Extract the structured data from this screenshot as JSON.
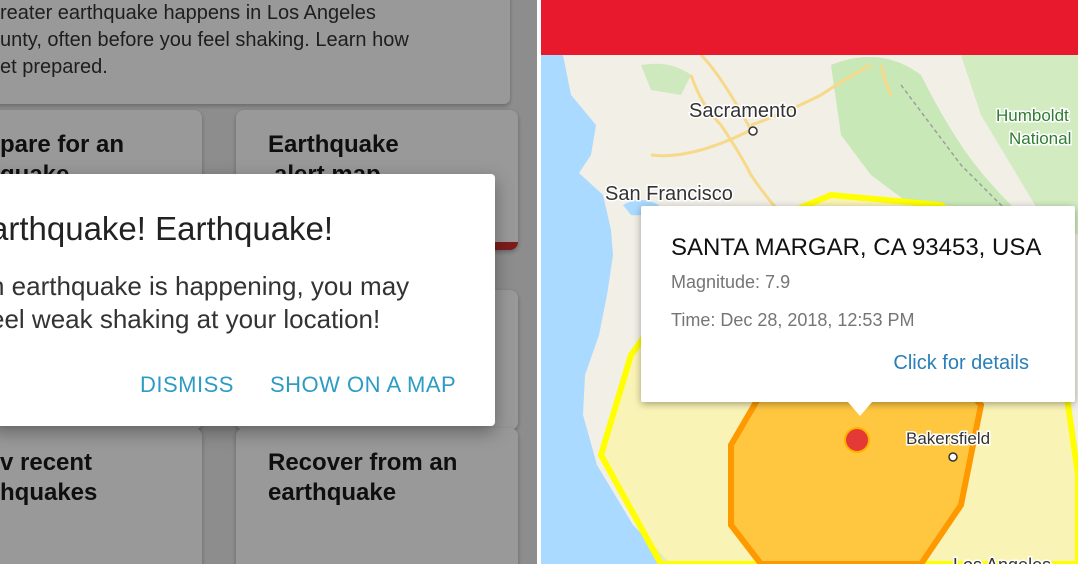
{
  "app": {
    "intro_lines": [
      "reater earthquake happens in Los Angeles",
      "unty, often before you feel shaking. Learn how",
      "et prepared."
    ],
    "cards": [
      {
        "lines": [
          "pare for an",
          "quake"
        ],
        "color": "#e02630"
      },
      {
        "lines": [
          "Earthquake",
          "alert map"
        ],
        "color": "#d32f2f"
      },
      {
        "lines": [
          "v recent",
          "hquakes"
        ],
        "color": "#7b1fa2"
      },
      {
        "lines": [
          "Recover from an",
          "earthquake"
        ],
        "color": "#388e3c"
      }
    ]
  },
  "dialog": {
    "title": "arthquake! Earthquake!",
    "message_lines": [
      "n earthquake is happening, you may",
      "eel weak shaking at your location!"
    ],
    "dismiss_label": "DISMISS",
    "show_map_label": "SHOW ON A MAP"
  },
  "map": {
    "header_color": "#e8192c",
    "labels": {
      "sacramento": "Sacramento",
      "san_francisco": "San Francisco",
      "humboldt_1": "Humboldt",
      "humboldt_2": "National",
      "bakersfield": "Bakersfield",
      "los_angeles": "Los Angeles"
    },
    "info": {
      "place": "SANTA MARGAR, CA 93453, USA",
      "magnitude": "Magnitude: 7.9",
      "time": "Time: Dec 28, 2018, 12:53 PM",
      "details_link": "Click for details"
    }
  }
}
